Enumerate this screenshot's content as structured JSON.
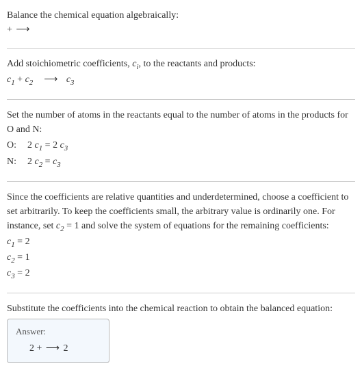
{
  "sec1": {
    "line1": "Balance the chemical equation algebraically:",
    "line2_left": " + ",
    "line2_arrow": "⟶"
  },
  "sec2": {
    "line1_a": "Add stoichiometric coefficients, ",
    "line1_c": "c",
    "line1_i": "i",
    "line1_b": ", to the reactants and products:",
    "c1": "c",
    "s1": "1",
    "plus": " + ",
    "c2": "c",
    "s2": "2",
    "arrow": "⟶",
    "c3": "c",
    "s3": "3"
  },
  "sec3": {
    "line1": "Set the number of atoms in the reactants equal to the number of atoms in the products for O and N:",
    "rowO_label": "O: ",
    "rowO_eq_a": "2 ",
    "rowO_eq_c1": "c",
    "rowO_eq_s1": "1",
    "rowO_eq_mid": " = 2 ",
    "rowO_eq_c3": "c",
    "rowO_eq_s3": "3",
    "rowN_label": "N: ",
    "rowN_eq_a": "2 ",
    "rowN_eq_c2": "c",
    "rowN_eq_s2": "2",
    "rowN_eq_mid": " = ",
    "rowN_eq_c3": "c",
    "rowN_eq_s3": "3"
  },
  "sec4": {
    "line1_a": "Since the coefficients are relative quantities and underdetermined, choose a coefficient to set arbitrarily. To keep the coefficients small, the arbitrary value is ordinarily one. For instance, set ",
    "line1_c2": "c",
    "line1_s2": "2",
    "line1_b": " = 1 and solve the system of equations for the remaining coefficients:",
    "r1_c": "c",
    "r1_s": "1",
    "r1_v": " = 2",
    "r2_c": "c",
    "r2_s": "2",
    "r2_v": " = 1",
    "r3_c": "c",
    "r3_s": "3",
    "r3_v": " = 2"
  },
  "sec5": {
    "line1": "Substitute the coefficients into the chemical reaction to obtain the balanced equation:",
    "answer_label": "Answer:",
    "answer_eq_a": "2  +  ",
    "answer_eq_arrow": "⟶",
    "answer_eq_b": " 2"
  }
}
